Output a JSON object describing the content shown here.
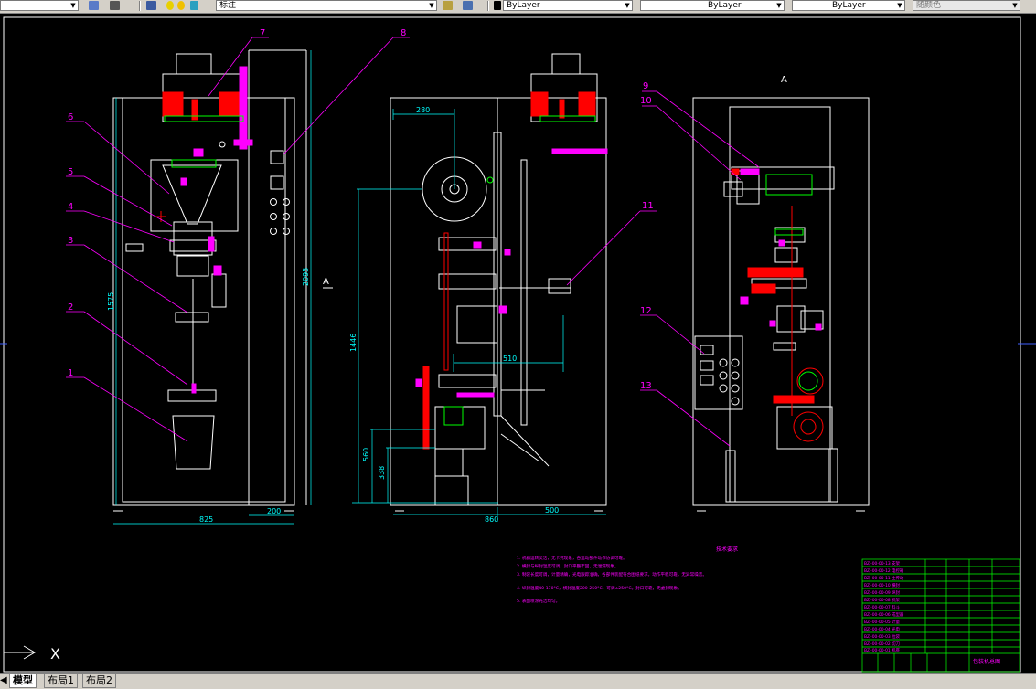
{
  "toolbar": {
    "annotation_layer": "标注",
    "color_combo": "ByLayer",
    "linetype_combo": "ByLayer",
    "lineweight_combo": "ByLayer",
    "plotstyle_combo": "随颜色"
  },
  "drawing": {
    "part_numbers": [
      "1",
      "2",
      "3",
      "4",
      "5",
      "6",
      "7",
      "8",
      "9",
      "10",
      "11",
      "12",
      "13"
    ],
    "view_label": "A",
    "section_mark": "A",
    "dimensions": {
      "front_width": "825",
      "front_right": "200",
      "front_height_1": "1575",
      "front_height_2": "2095",
      "side_top": "280",
      "side_mid": "510",
      "side_height": "1446",
      "side_h2": "560",
      "side_h3": "338",
      "side_bottom_left": "860",
      "side_bottom_right": "500"
    },
    "notes_title": "技术要求",
    "notes": [
      "1. 机器运转灵活，无卡死现象，各运动部件动作协调可靠。",
      "2. 横封与纵封温度可调，封口平整牢固，无泄漏现象。",
      "3. 制袋长度可调，计量精确，光电跟踪准确，各部件装配符合图纸要求，动作平稳可靠，无异常噪音。",
      "4. 纵封温度40-170°C，横封温度200-250°C，可调±250°C。封口可靠，无虚封现象。",
      "5. 表面喷涂光洁均匀。"
    ]
  },
  "title_block": {
    "drawing_name": "包装机总图",
    "rows": [
      "BZJ-00-00-13 支架",
      "BZJ-00-00-12 电控箱",
      "BZJ-00-00-11 主传动",
      "BZJ-00-00-10 横封",
      "BZJ-00-00-09 纵封",
      "BZJ-00-00-08 机架",
      "BZJ-00-00-07 料斗",
      "BZJ-00-00-06 成型器",
      "BZJ-00-00-05 计量",
      "BZJ-00-00-04 光电",
      "BZJ-00-00-03 拉袋",
      "BZJ-00-00-02 切刀",
      "BZJ-00-00-01 机座"
    ]
  },
  "ucs": {
    "x_label": "X"
  },
  "layout_tabs": [
    {
      "label": "模型",
      "active": true
    },
    {
      "label": "布局1",
      "active": false
    },
    {
      "label": "布局2",
      "active": false
    }
  ],
  "colors": {
    "background": "#000000",
    "lines": "#ffffff",
    "leaders": "#ff00ff",
    "dims": "#00ffff",
    "red": "#ff0000",
    "green": "#00ff00",
    "chrome": "#d4d0c8"
  }
}
